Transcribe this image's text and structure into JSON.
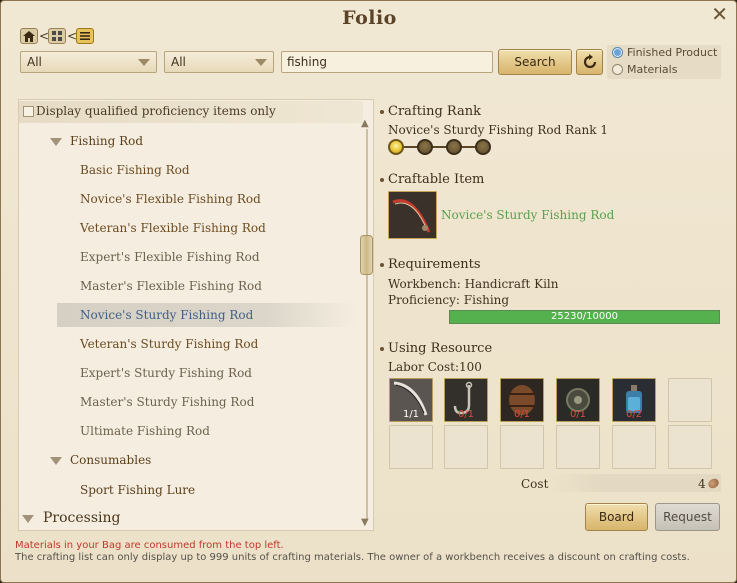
{
  "window": {
    "title": "Folio",
    "close_symbol": "✕"
  },
  "breadcrumb": {
    "separator": "<"
  },
  "filters": {
    "category1": "All",
    "category2": "All",
    "search_value": "fishing",
    "search_label": "Search",
    "radio_finished": "Finished Product",
    "radio_materials": "Materials",
    "selected_radio": "Finished Product"
  },
  "tree": {
    "qualified_label": "Display qualified proficiency items only",
    "fishing_rod_cat": "Fishing Rod",
    "items": [
      "Basic Fishing Rod",
      "Novice's Flexible Fishing Rod",
      "Veteran's Flexible Fishing Rod",
      "Expert's Flexible Fishing Rod",
      "Master's Flexible Fishing Rod",
      "Novice's Sturdy Fishing Rod",
      "Veteran's Sturdy Fishing Rod",
      "Expert's Sturdy Fishing Rod",
      "Master's Sturdy Fishing Rod",
      "Ultimate Fishing Rod"
    ],
    "consumables_cat": "Consumables",
    "consumable_items": [
      "Sport Fishing Lure"
    ],
    "processing_cat": "Processing",
    "selected_item": "Novice's Sturdy Fishing Rod"
  },
  "detail": {
    "crafting_rank_title": "Crafting Rank",
    "rank_name": "Novice's Sturdy Fishing Rod Rank 1",
    "rank_steps_total": 4,
    "rank_steps_filled": 1,
    "craftable_title": "Craftable Item",
    "craftable_name": "Novice's Sturdy Fishing Rod",
    "requirements_title": "Requirements",
    "workbench": "Workbench: Handicraft Kiln",
    "proficiency": "Proficiency: Fishing",
    "proficiency_value": "25230/10000",
    "proficiency_fraction": 1.0,
    "resource_title": "Using Resource",
    "labor_cost": "Labor Cost:100",
    "resources": [
      {
        "icon": "fishing-rod-icon",
        "qty": "1/1"
      },
      {
        "icon": "hook-icon",
        "qty": "0/1"
      },
      {
        "icon": "barrel-icon",
        "qty": "0/1"
      },
      {
        "icon": "reel-icon",
        "qty": "0/1"
      },
      {
        "icon": "potion-bottle-icon",
        "qty": "0/2"
      }
    ],
    "cost_label": "Cost",
    "cost_value": "4",
    "board_label": "Board",
    "request_label": "Request"
  },
  "footer": {
    "warning": "Materials in your Bag are consumed from the top left.",
    "info": "The crafting list can only display up to 999 units of crafting materials. The owner of a workbench receives a discount on crafting costs."
  },
  "colors": {
    "green_item": "#5aa04f",
    "warning_red": "#c0392b",
    "selected_blue": "#3f5f87"
  }
}
